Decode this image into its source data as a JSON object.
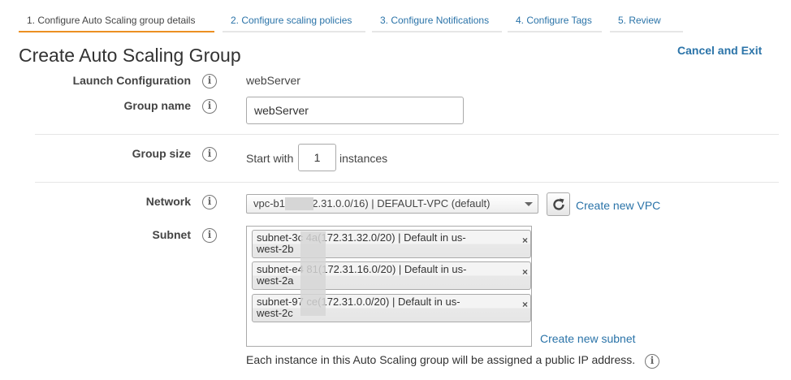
{
  "wizard": {
    "tabs": [
      {
        "label": "1. Configure Auto Scaling group details",
        "active": true
      },
      {
        "label": "2. Configure scaling policies",
        "active": false
      },
      {
        "label": "3. Configure Notifications",
        "active": false
      },
      {
        "label": "4. Configure Tags",
        "active": false
      },
      {
        "label": "5. Review",
        "active": false
      }
    ],
    "active_color": "#ec8f22"
  },
  "page": {
    "title": "Create Auto Scaling Group",
    "cancel_label": "Cancel and Exit"
  },
  "form": {
    "launch_config": {
      "label": "Launch Configuration",
      "value": "webServer"
    },
    "group_name": {
      "label": "Group name",
      "value": "webServer"
    },
    "group_size": {
      "label": "Group size",
      "prefix": "Start with",
      "value": "1",
      "suffix": "instances"
    },
    "network": {
      "label": "Network",
      "selected": "vpc-b1        4 (172.31.0.0/16) | DEFAULT-VPC (default)",
      "create_link": "Create new VPC"
    },
    "subnet": {
      "label": "Subnet",
      "chips": [
        {
          "line1": "subnet-3c         4a(172.31.32.0/20) | Default in us-",
          "line2": "west-2b"
        },
        {
          "line1": "subnet-e4         81(172.31.16.0/20) | Default in us-",
          "line2": "west-2a"
        },
        {
          "line1": "subnet-97         ce(172.31.0.0/20) | Default in us-",
          "line2": "west-2c"
        }
      ],
      "remove_glyph": "×",
      "create_link": "Create new subnet"
    },
    "info_glyph": "i",
    "footnote": "Each instance in this Auto Scaling group will be assigned a public IP address."
  },
  "colors": {
    "link": "#2a73a8",
    "accent_tab": "#ec8f22"
  }
}
